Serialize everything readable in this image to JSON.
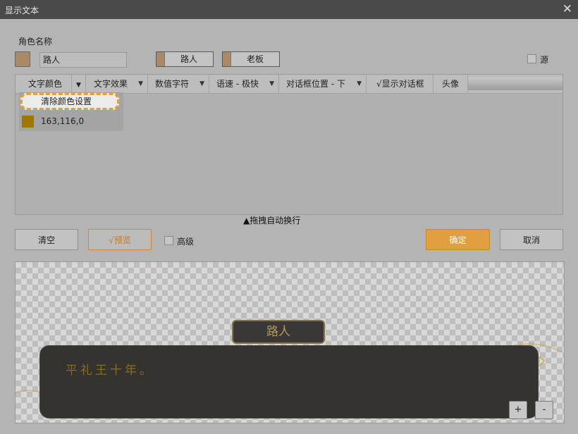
{
  "window": {
    "title": "显示文本",
    "close_glyph": "✕"
  },
  "role": {
    "label": "角色名称",
    "swatch_color": "#a88a66",
    "name_value": "路人",
    "characters": [
      {
        "name": "路人",
        "color": "#a88a66"
      },
      {
        "name": "老板",
        "color": "#a88a66"
      }
    ],
    "source_label": "源"
  },
  "toolbar": {
    "items": [
      {
        "label": "文字颜色",
        "arrow": "▼"
      },
      {
        "label": "文字效果",
        "arrow": "▼"
      },
      {
        "label": "数值字符",
        "arrow": "▼"
      },
      {
        "label": "语速 - 极快",
        "arrow": "▼"
      },
      {
        "label": "对话框位置 - 下",
        "arrow": "▼"
      },
      {
        "label": "√显示对话框"
      },
      {
        "label": "头像"
      }
    ]
  },
  "color_dropdown": {
    "clear_label": "清除颜色设置",
    "options": [
      {
        "value": "163,116,0",
        "color": "#a37400"
      }
    ]
  },
  "drag_hint": "▲拖拽自动换行",
  "actions": {
    "clear": "清空",
    "preview": "√预览",
    "advanced": "高级",
    "ok": "确定",
    "cancel": "取消"
  },
  "preview": {
    "speaker": "路人",
    "text": "平礼王十年。",
    "zoom_in": "+",
    "zoom_out": "-"
  }
}
